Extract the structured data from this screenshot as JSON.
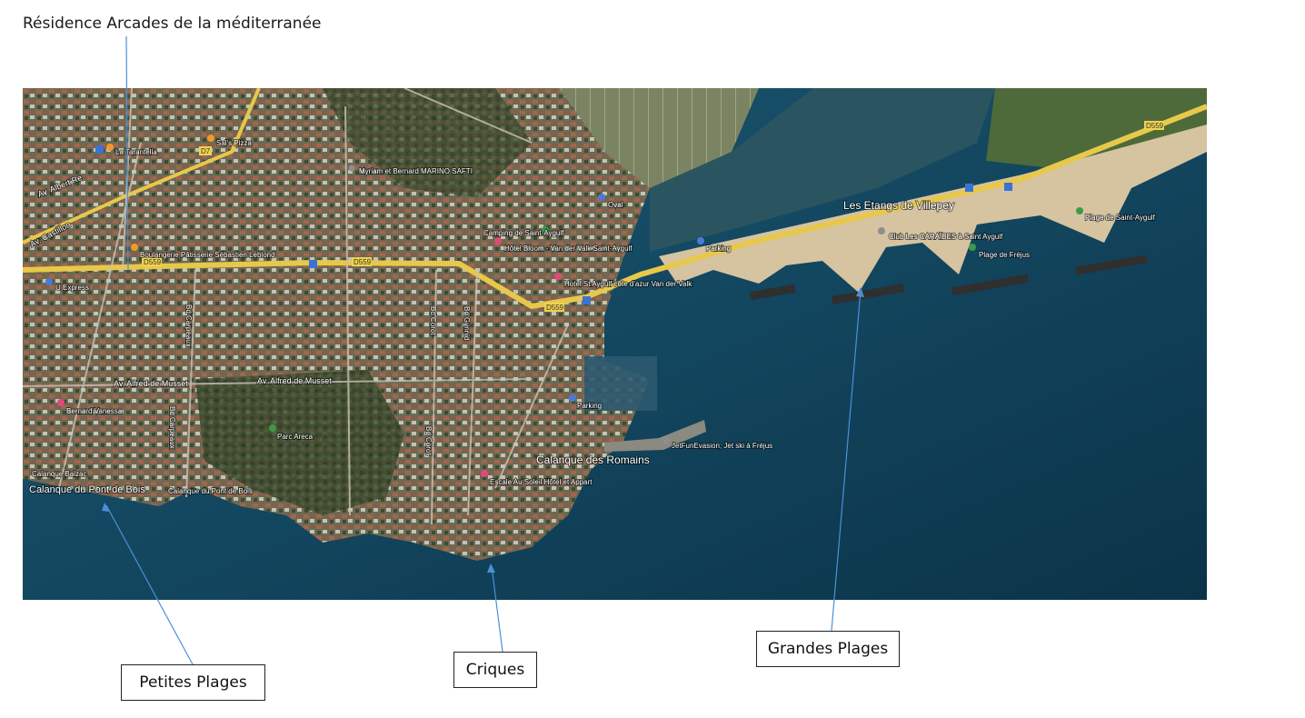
{
  "top_caption": "Résidence Arcades de la méditerranée",
  "callouts": {
    "petites_plages": "Petites Plages",
    "criques": "Criques",
    "grandes_plages": "Grandes Plages"
  },
  "map": {
    "big_labels": {
      "etangs": "Les Etangs de Villepey",
      "calanque_romains": "Calanque des Romains",
      "calanque_pont_bois": "Calanque du Pont de Bois"
    },
    "road_badges": {
      "d559_a": "D559",
      "d559_b": "D559",
      "d559_c": "D559",
      "d559_d": "D559",
      "d7": "D7"
    },
    "street_labels": {
      "av_albert": "Av. Albert Re",
      "av_castillon": "Av. Castillon",
      "av_musset_1": "Av. Alfred de Musset",
      "av_musset_2": "Av. Alfred de Musset",
      "bd_carpeaux_1": "Bd Carpeaux",
      "bd_carpeaux_2": "Bd Carpeaux",
      "bd_corot_1": "Bd Corot",
      "bd_corot_2": "Bd Corot",
      "bd_gynnid": "Bd Gynnid"
    },
    "poi": {
      "la_tarantella": "La Tarantella",
      "sals_pizza": "Sal's Pizza",
      "myriam": "Myriam et Bernard MARINO SAFTI",
      "boulangerie": "Boulangerie Pâtisserie Sébastien Leblond",
      "u_express": "U Express",
      "camping": "Camping de Saint-Aygulf",
      "hotel_bloom": "Hôtel Bloom - Van der Valk Saint-Aygulf",
      "oval": "Oval",
      "parking_1": "Parking",
      "hotel_st_aygulf": "Hotel St Aygulf côte d'azur Van der Valk",
      "bernard_vanessa": "Bernard Vanessa",
      "parc_areca": "Parc Areca",
      "calanque_balzac": "Calanque Balzac",
      "parking_2": "Parking",
      "jetfun": "JetFunEvasion, Jet ski à Fréjus",
      "escale": "Escale Au Soleil Hôtel et Appart",
      "plage_saint_aygulf": "Plage de Saint-Aygulf",
      "plage_frejus": "Plage de Fréjus",
      "club_caraibes": "Club Les CARAÏBES à Saint Aygulf"
    }
  },
  "colors": {
    "sea_deep": "#0d3a50",
    "sea_mid": "#1f5a72",
    "land": "#5a5a48",
    "sand": "#d9c9a8",
    "road": "#e8c84a"
  }
}
